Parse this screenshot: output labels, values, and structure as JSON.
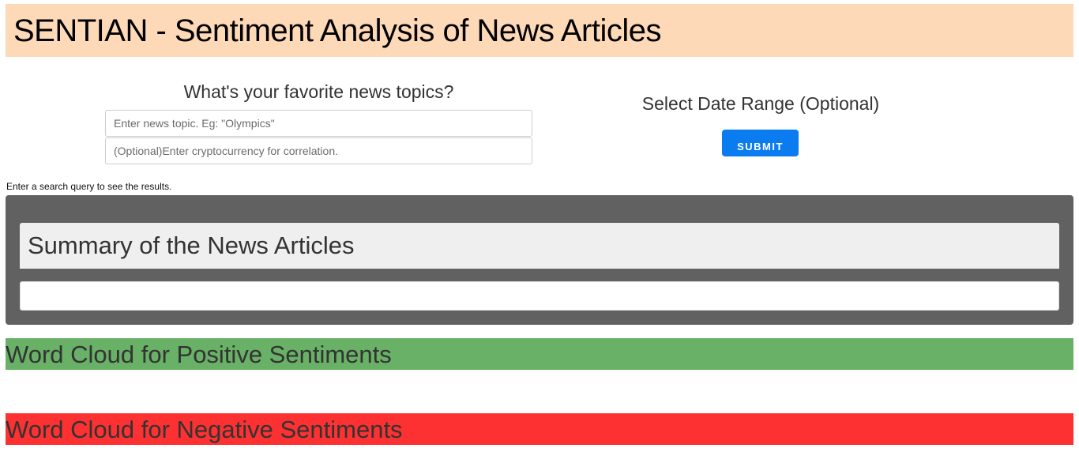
{
  "header": {
    "title": "SENTIAN - Sentiment Analysis of News Articles"
  },
  "search": {
    "heading": "What's your favorite news topics?",
    "topic_placeholder": "Enter news topic. Eg: \"Olympics\"",
    "topic_value": "",
    "crypto_placeholder": "(Optional)Enter cryptocurrency for correlation.",
    "crypto_value": ""
  },
  "date_range": {
    "heading": "Select Date Range (Optional)"
  },
  "submit": {
    "label": "SUBMIT"
  },
  "status": {
    "text": "Enter a search query to see the results."
  },
  "summary": {
    "title": "Summary of the News Articles",
    "body": ""
  },
  "word_clouds": {
    "positive_title": "Word Cloud for Positive Sentiments",
    "negative_title": "Word Cloud for Negative Sentiments"
  },
  "colors": {
    "header_bg": "#fdd9b8",
    "submit_bg": "#0a7cf0",
    "summary_panel_bg": "#616161",
    "positive_bg": "#68b166",
    "negative_bg": "#fd3131"
  }
}
